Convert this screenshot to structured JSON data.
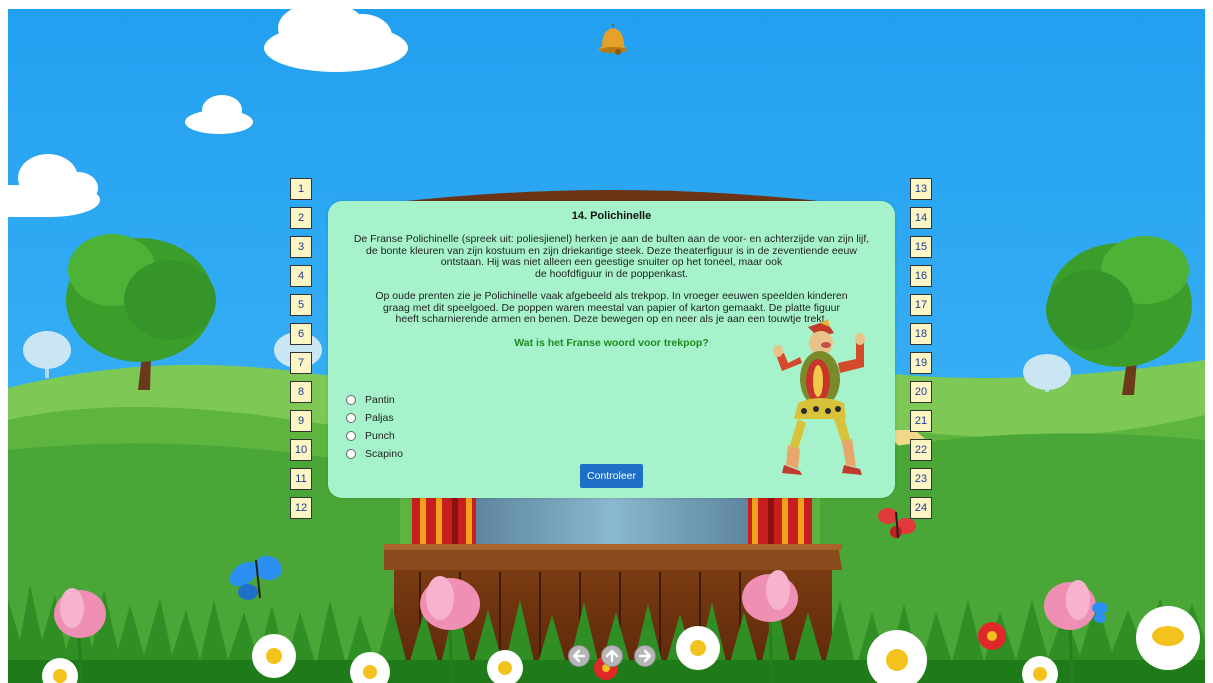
{
  "lesson": {
    "title": "14. Polichinelle",
    "paragraph1": [
      "De Franse Polichinelle (spreek uit: poliesjienel) herken je aan de bulten aan de voor- en achterzijde van zijn lijf,",
      "de bonte kleuren van zijn kostuum en zijn driekantige steek. Deze theaterfiguur is in de zeventiende eeuw",
      "ontstaan. Hij was niet alleen een geestige snuiter op het toneel, maar ook",
      "de hoofdfiguur in de poppenkast."
    ],
    "paragraph2": [
      "Op oude prenten zie je Polichinelle vaak afgebeeld als trekpop. In vroeger eeuwen speelden kinderen",
      "graag met dit speelgoed. De poppen waren meestal van papier of karton gemaakt. De platte figuur",
      "heeft scharnierende armen en benen. Deze bewegen op en neer als je aan een touwtje trekt."
    ],
    "question": "Wat is het Franse woord voor trekpop?",
    "options": [
      "Pantin",
      "Paljas",
      "Punch",
      "Scapino"
    ],
    "check_label": "Controleer"
  },
  "left_numbers": [
    "1",
    "2",
    "3",
    "4",
    "5",
    "6",
    "7",
    "8",
    "9",
    "10",
    "11",
    "12"
  ],
  "right_numbers": [
    "13",
    "14",
    "15",
    "16",
    "17",
    "18",
    "19",
    "20",
    "21",
    "22",
    "23",
    "24"
  ],
  "nav_icons": [
    "arrow-left-icon",
    "arrow-up-icon",
    "arrow-right-icon"
  ],
  "colors": {
    "sky": "#2aa5f2",
    "panel": "#a6f3cb",
    "button": "#1d6fc7",
    "question": "#1f8a1f",
    "number_box": "#fdf6c4",
    "number_text": "#1a3c8c"
  }
}
